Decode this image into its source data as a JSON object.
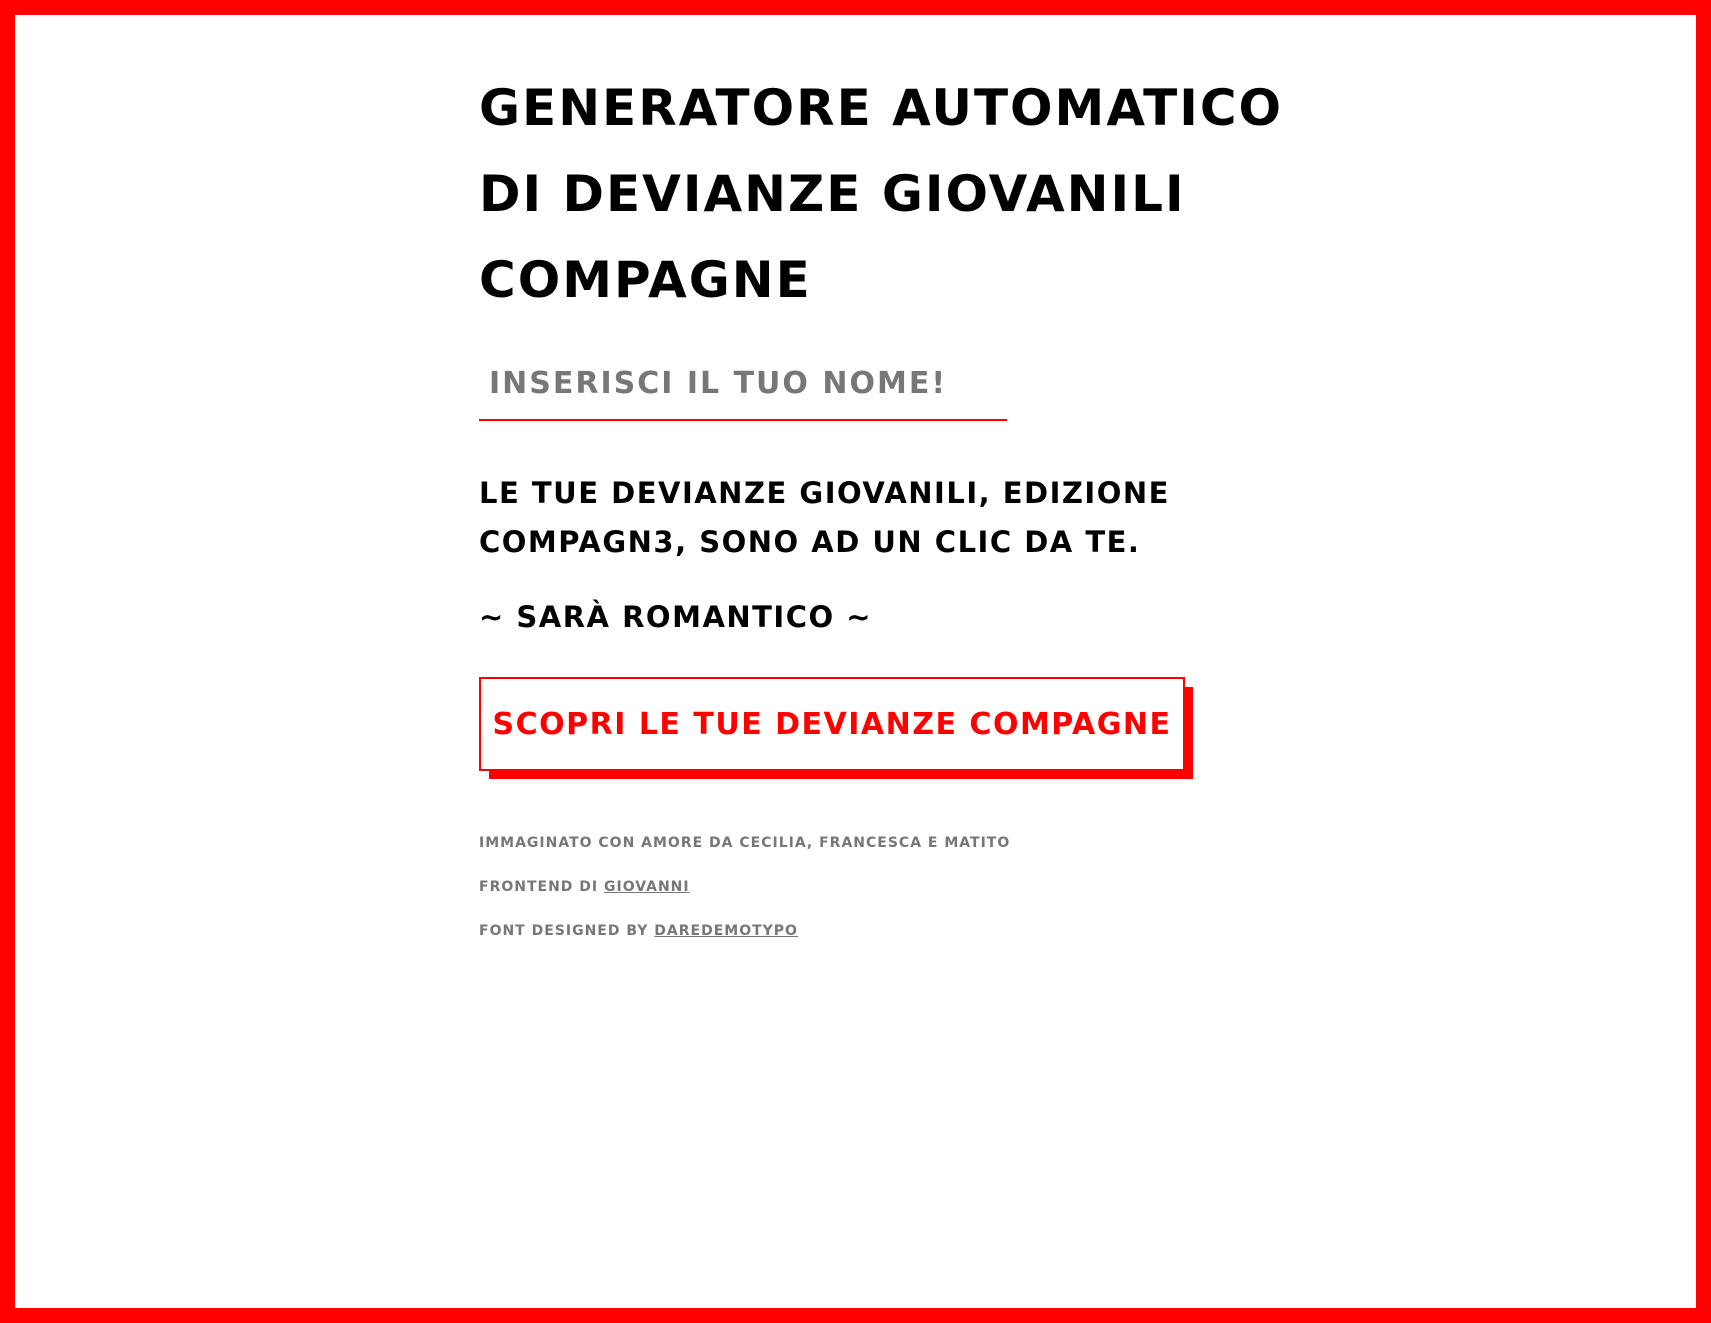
{
  "header": {
    "title_lines": [
      "Generatore automatico",
      "di devianze giovanili",
      "compagne"
    ]
  },
  "form": {
    "name_placeholder": "Inserisci il tuo nome!",
    "name_value": ""
  },
  "intro": {
    "tagline": "Le tue devianze giovanili, edizione compagn3, sono ad un clic da te.",
    "romantic": "~ Sarà romantico ~"
  },
  "cta": {
    "label": "Scopri le tue devianze compagne"
  },
  "footer": {
    "credits": "Immaginato con amore da Cecilia, Francesca e Matito",
    "frontend_prefix": "Frontend di",
    "frontend_link": "Giovanni",
    "font_prefix": "Font designed by",
    "font_link": "Daredemotypo"
  },
  "colors": {
    "accent": "#ff0000",
    "text": "#000000",
    "muted": "#777777",
    "background": "#ffffff"
  }
}
